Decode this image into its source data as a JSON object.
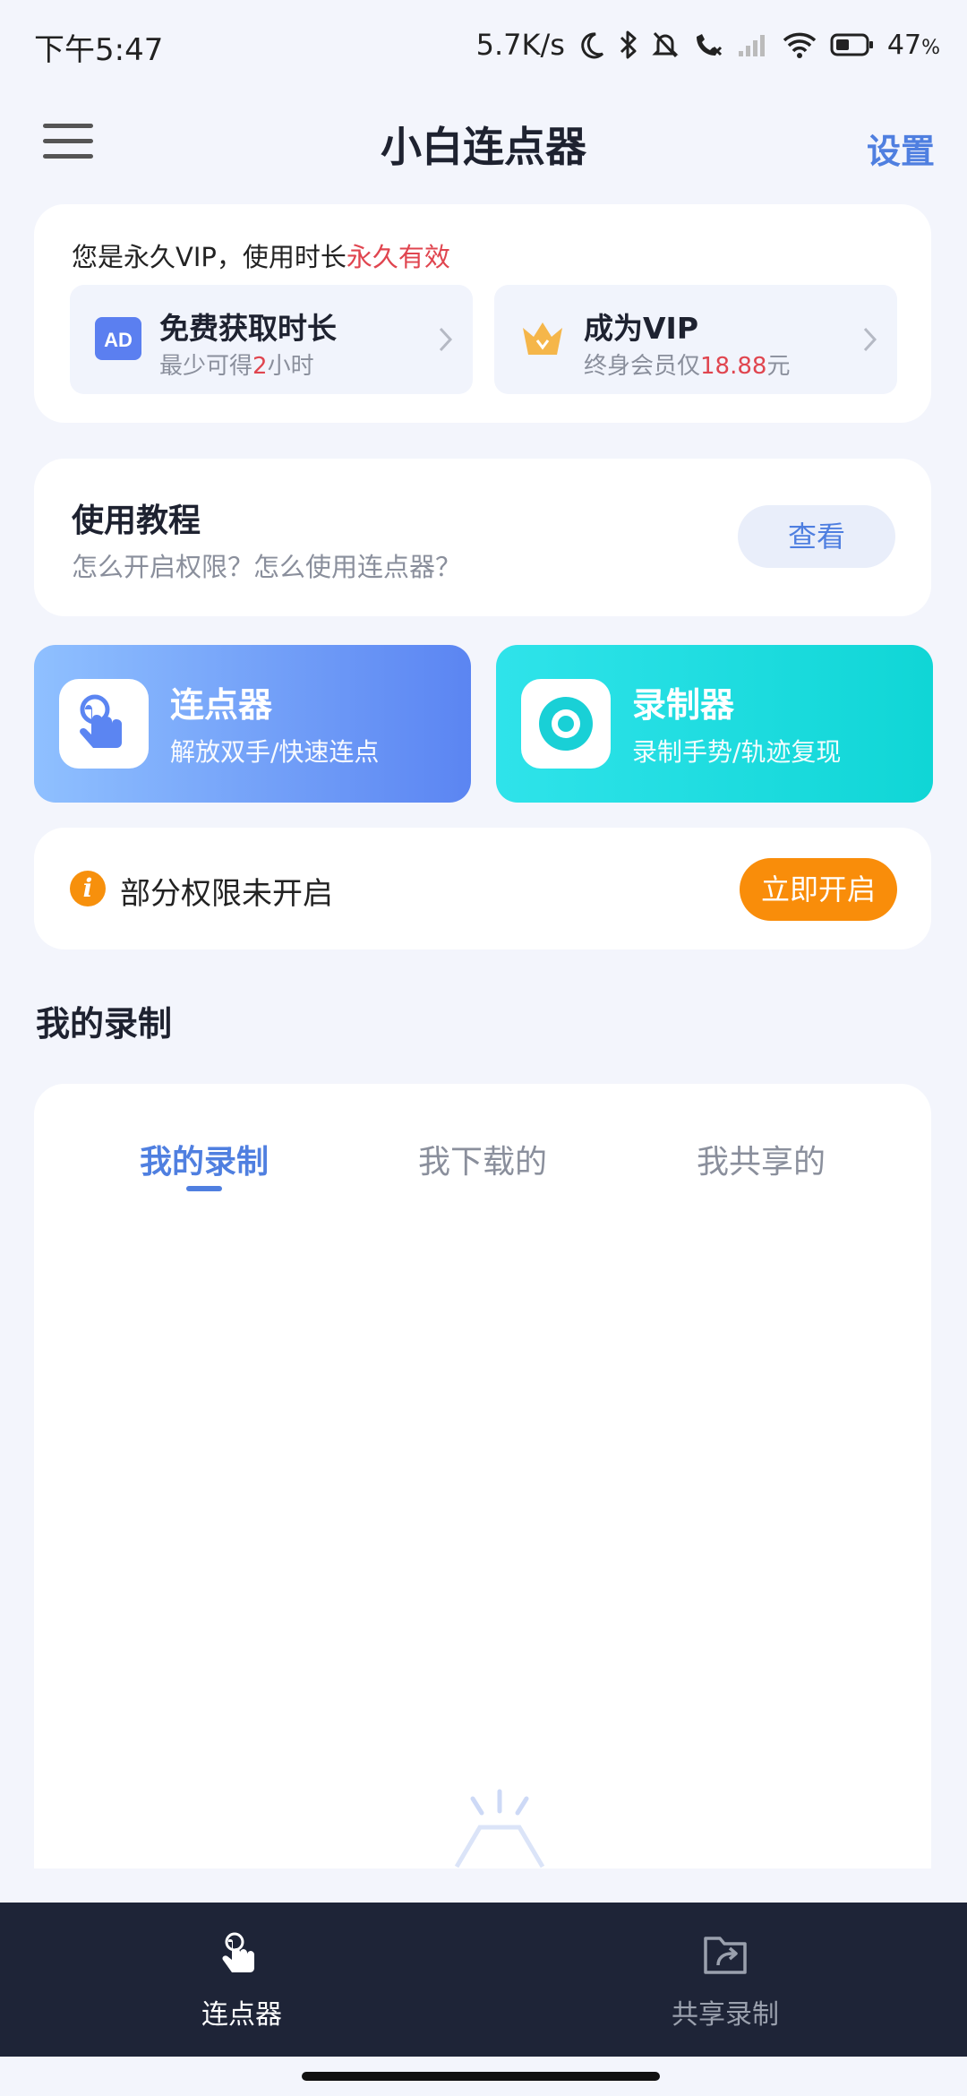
{
  "status_bar": {
    "time": "下午5:47",
    "net_speed": "5.7K/s",
    "battery_pct": "47",
    "battery_unit": "%"
  },
  "header": {
    "title": "小白连点器",
    "settings_label": "设置"
  },
  "vip": {
    "status_prefix": "您是永久VIP，使用时长",
    "status_value": "永久有效",
    "free_time": {
      "badge": "AD",
      "title": "免费获取时长",
      "sub_prefix": "最少可得",
      "sub_value": "2",
      "sub_suffix": "小时"
    },
    "become_vip": {
      "title": "成为VIP",
      "sub_prefix": "终身会员仅",
      "sub_value": "18.88",
      "sub_suffix": "元"
    }
  },
  "tutorial": {
    "title": "使用教程",
    "subtitle": "怎么开启权限？怎么使用连点器？",
    "button_label": "查看"
  },
  "features": {
    "clicker": {
      "title": "连点器",
      "subtitle": "解放双手/快速连点"
    },
    "recorder": {
      "title": "录制器",
      "subtitle": "录制手势/轨迹复现"
    }
  },
  "permission": {
    "text": "部分权限未开启",
    "button_label": "立即开启"
  },
  "records": {
    "section_title": "我的录制",
    "tabs": [
      {
        "label": "我的录制",
        "active": true
      },
      {
        "label": "我下载的",
        "active": false
      },
      {
        "label": "我共享的",
        "active": false
      }
    ]
  },
  "bottom_nav": {
    "items": [
      {
        "label": "连点器",
        "icon": "tap-hand-icon",
        "active": true
      },
      {
        "label": "共享录制",
        "icon": "share-folder-icon",
        "active": false
      }
    ]
  },
  "colors": {
    "accent": "#4f7fe0",
    "highlight_red": "#e0454f",
    "orange": "#f98d0a",
    "nav_bg": "#1e2437"
  }
}
